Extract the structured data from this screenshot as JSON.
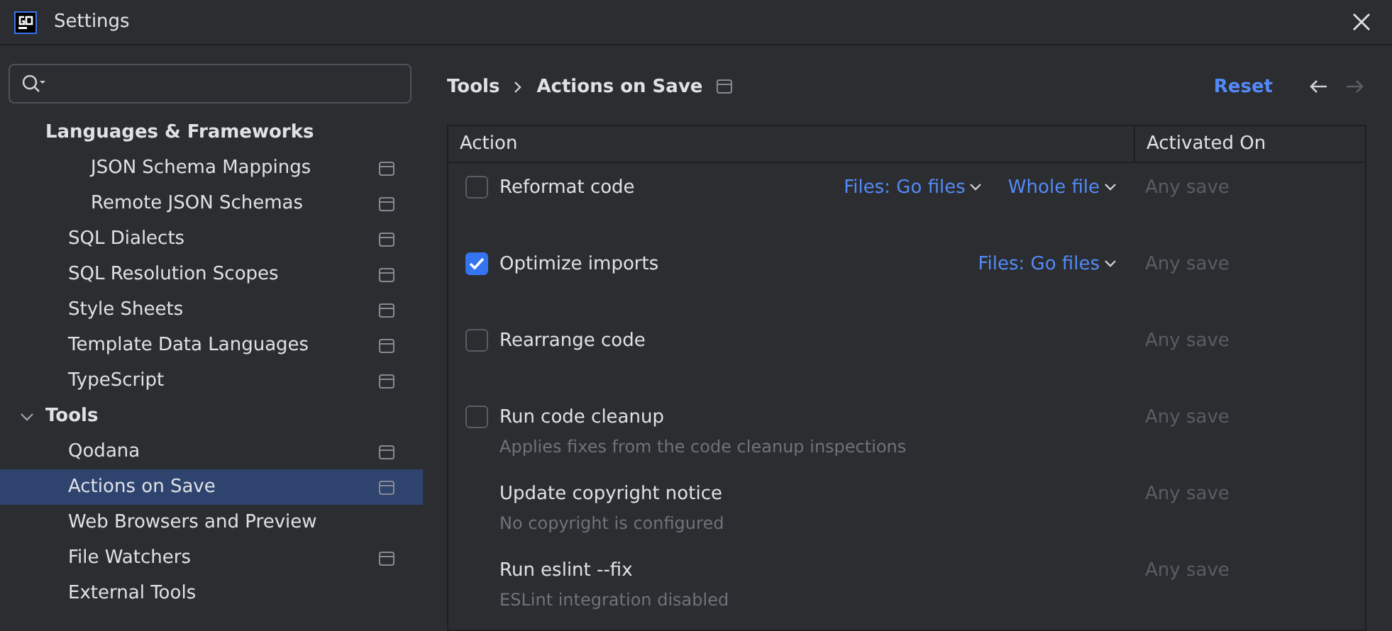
{
  "window": {
    "title": "Settings"
  },
  "sidebar": {
    "items": [
      {
        "label": "Languages & Frameworks",
        "children": [
          {
            "children": [
              {
                "label": "JSON Schema Mappings",
                "project_level": true,
                "selected": false
              },
              {
                "label": "Remote JSON Schemas",
                "project_level": true,
                "selected": false
              }
            ]
          },
          {
            "label": "SQL Dialects",
            "project_level": true,
            "selected": false
          },
          {
            "label": "SQL Resolution Scopes",
            "project_level": true,
            "selected": false
          },
          {
            "label": "Style Sheets",
            "project_level": true,
            "selected": false
          },
          {
            "label": "Template Data Languages",
            "project_level": true,
            "selected": false
          },
          {
            "label": "TypeScript",
            "project_level": true,
            "selected": false
          }
        ]
      },
      {
        "label": "Tools",
        "expanded": true,
        "children": [
          {
            "label": "Qodana",
            "project_level": true,
            "selected": false
          },
          {
            "label": "Actions on Save",
            "project_level": true,
            "selected": true
          },
          {
            "label": "Web Browsers and Preview",
            "project_level": false,
            "selected": false
          },
          {
            "label": "File Watchers",
            "project_level": true,
            "selected": false
          },
          {
            "label": "External Tools",
            "project_level": false,
            "selected": false
          }
        ]
      }
    ]
  },
  "breadcrumb": [
    "Tools",
    "Actions on Save"
  ],
  "reset": "Reset",
  "table": {
    "columns": [
      "Action",
      "Activated On"
    ],
    "rows": [
      {
        "name": "Reformat code",
        "checked": false,
        "options": [
          "Files: Go files",
          "Whole file"
        ],
        "activated": "Any save"
      },
      {
        "name": "Optimize imports",
        "checked": true,
        "options": [
          "Files: Go files"
        ],
        "activated": "Any save"
      },
      {
        "name": "Rearrange code",
        "checked": false,
        "activated": "Any save"
      },
      {
        "name": "Run code cleanup",
        "checked": false,
        "description": "Applies fixes from the code cleanup inspections",
        "activated": "Any save"
      },
      {
        "name": "Update copyright notice",
        "description": "No copyright is configured",
        "activated": "Any save"
      },
      {
        "name": "Run eslint --fix",
        "description": "ESLint integration disabled",
        "activated": "Any save"
      }
    ]
  }
}
